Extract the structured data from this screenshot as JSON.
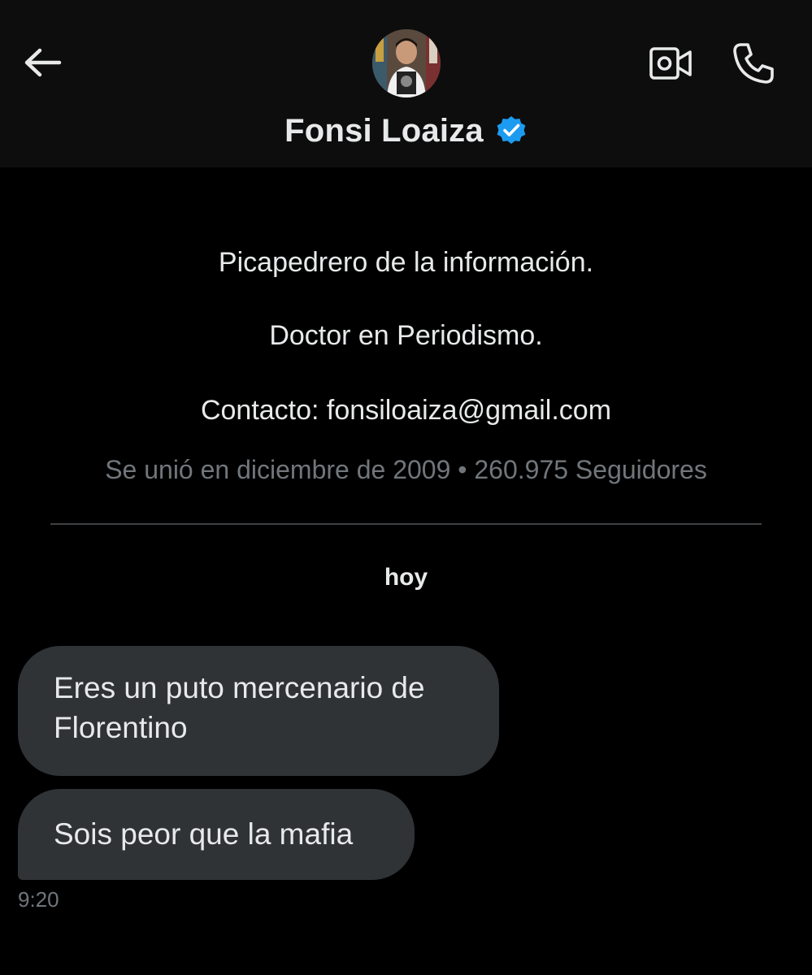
{
  "header": {
    "back_icon": "arrow-left-icon",
    "profile_name": "Fonsi Loaiza",
    "verified_icon": "verified-badge-icon",
    "verified_color": "#1d9bf0",
    "video_icon": "video-camera-icon",
    "phone_icon": "phone-icon"
  },
  "profile": {
    "bio_line1": "Picapedrero de la información.",
    "bio_line2": "Doctor en Periodismo.",
    "bio_line3": "Contacto: fonsiloaiza@gmail.com",
    "meta": "Se unió en diciembre de 2009 • 260.975 Seguidores"
  },
  "conversation": {
    "day_label": "hoy",
    "messages": [
      {
        "text": "Eres un puto mercenario de Florentino"
      },
      {
        "text": "Sois peor que la mafia"
      }
    ],
    "timestamp": "9:20"
  },
  "colors": {
    "background": "#000000",
    "header_bg": "#0d0d0d",
    "bubble_bg": "#2f3336",
    "primary_text": "#e7e9ea",
    "secondary_text": "#71767b"
  }
}
